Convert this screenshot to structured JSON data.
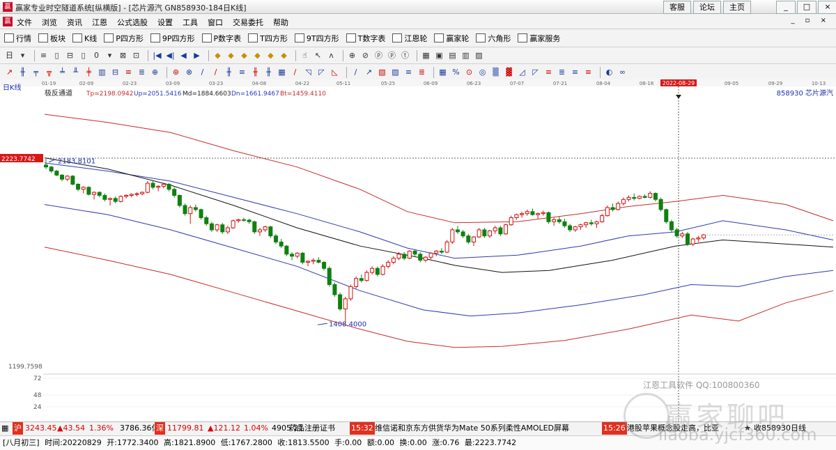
{
  "window": {
    "title": "赢家专业时空隧道系统[纵横版] - [芯片源汽  GN858930-184日K线]",
    "links": [
      "客服",
      "论坛",
      "主页"
    ],
    "controls": [
      "_",
      "□",
      "×"
    ]
  },
  "menu": {
    "items": [
      "文件",
      "浏览",
      "资讯",
      "江恩",
      "公式选股",
      "设置",
      "工具",
      "窗口",
      "交易委托",
      "帮助"
    ],
    "mdi_controls": "_ ▫ ×"
  },
  "toolbar1": [
    {
      "label": "行情",
      "icon": "table-icon"
    },
    {
      "label": "板块",
      "icon": "blocks-icon"
    },
    {
      "label": "K线",
      "icon": "candle-icon"
    },
    {
      "label": "P四方形",
      "icon": "p-square-icon"
    },
    {
      "label": "9P四方形",
      "icon": "9p-square-icon"
    },
    {
      "label": "P数字表",
      "icon": "p-number-icon"
    },
    {
      "label": "T四方形",
      "icon": "t-square-icon"
    },
    {
      "label": "9T四方形",
      "icon": "9t-square-icon"
    },
    {
      "label": "T数字表",
      "icon": "t-number-icon"
    },
    {
      "label": "江恩轮",
      "icon": "gann-wheel-icon"
    },
    {
      "label": "赢家轮",
      "icon": "winner-wheel-icon"
    },
    {
      "label": "六角形",
      "icon": "hexagon-icon"
    },
    {
      "label": "赢家服务",
      "icon": "service-icon"
    }
  ],
  "toolbar2": [
    "日",
    "▾",
    "≡",
    "▯",
    "⊟",
    "▯",
    "0",
    "▾",
    "⊠",
    "⊡",
    "|◀",
    "◀|",
    "◀",
    "▶",
    "◆",
    "◆",
    "◆",
    "◆",
    "◆",
    "◆",
    "☝",
    "↖",
    "ʌ",
    "⊕",
    "⊘",
    "ⓟ",
    "ⓟ",
    "ⓣ",
    "▦",
    "▣",
    "▤",
    "▥",
    "▨"
  ],
  "toolbar3": [
    "↗",
    "╫",
    "╤",
    "╦",
    "╧",
    "╨",
    "╪",
    "▥",
    "⊟",
    "≡",
    "≣",
    "⊕",
    "⊛",
    "⊗",
    "/",
    "/",
    "╫",
    "≡",
    "╫",
    "╫",
    "▦",
    "/",
    "◹",
    "◸",
    "◺",
    "/",
    "↗",
    "▧",
    "▨",
    "≡",
    "≣",
    "▦",
    "%",
    "⊙",
    "◎",
    "▒",
    "▓",
    "◿",
    "◸",
    "≡",
    "≣",
    "≡",
    "≡",
    "◐",
    "∞"
  ],
  "chart": {
    "period": "日K线",
    "indicator": {
      "name": "极反通道",
      "tp": "Tp=2198.0942",
      "up": "Up=2051.5416",
      "md": "Md=1884.6603",
      "dn": "Dn=1661.9467",
      "bt": "Bt=1459.4110"
    },
    "stock": "858930  芯片源汽",
    "dates": [
      "01-19",
      "02-09",
      "02-23",
      "03-09",
      "03-23",
      "04-08",
      "04-22",
      "05-11",
      "05-25",
      "06-09",
      "06-23",
      "07-07",
      "07-21",
      "08-04",
      "08-18",
      "09-05",
      "09-29",
      "10-13"
    ],
    "cursor_date": "2022-08-29",
    "cursor_price": "2223.7742",
    "high_label": "2183.8101",
    "low_label": "1408.4000",
    "bottom_price": "1199.7598",
    "volume_ticks": [
      "72",
      "48",
      "24"
    ],
    "colors": {
      "outer": "#c62b2b",
      "inner": "#2b3ab0",
      "mid": "#111111",
      "up": "#d01010",
      "down": "#108010"
    }
  },
  "chart_data": {
    "type": "candlestick",
    "title": "",
    "ylim": [
      1199.7598,
      2300
    ],
    "candles": [
      [
        2190,
        2220,
        2170,
        2180
      ],
      [
        2180,
        2185,
        2150,
        2160
      ],
      [
        2160,
        2165,
        2135,
        2140
      ],
      [
        2140,
        2145,
        2110,
        2120
      ],
      [
        2120,
        2140,
        2110,
        2135
      ],
      [
        2135,
        2140,
        2090,
        2095
      ],
      [
        2095,
        2100,
        2060,
        2070
      ],
      [
        2070,
        2085,
        2050,
        2080
      ],
      [
        2080,
        2085,
        2040,
        2045
      ],
      [
        2045,
        2060,
        2020,
        2055
      ],
      [
        2055,
        2060,
        2030,
        2040
      ],
      [
        2040,
        2050,
        2010,
        2020
      ],
      [
        2020,
        2030,
        1990,
        2025
      ],
      [
        2025,
        2035,
        2000,
        2010
      ],
      [
        2010,
        2040,
        2005,
        2035
      ],
      [
        2035,
        2045,
        2025,
        2040
      ],
      [
        2040,
        2050,
        2030,
        2045
      ],
      [
        2045,
        2055,
        2035,
        2048
      ],
      [
        2048,
        2060,
        2040,
        2055
      ],
      [
        2055,
        2110,
        2050,
        2100
      ],
      [
        2100,
        2110,
        2070,
        2080
      ],
      [
        2080,
        2090,
        2060,
        2085
      ],
      [
        2085,
        2100,
        2075,
        2095
      ],
      [
        2095,
        2100,
        2060,
        2070
      ],
      [
        2070,
        2080,
        2030,
        2040
      ],
      [
        2040,
        2045,
        1980,
        1990
      ],
      [
        1990,
        2000,
        1940,
        1950
      ],
      [
        1950,
        1990,
        1900,
        1980
      ],
      [
        1980,
        1995,
        1960,
        1970
      ],
      [
        1970,
        1975,
        1920,
        1930
      ],
      [
        1930,
        1940,
        1890,
        1900
      ],
      [
        1900,
        1910,
        1860,
        1870
      ],
      [
        1870,
        1900,
        1860,
        1895
      ],
      [
        1895,
        1905,
        1850,
        1860
      ],
      [
        1860,
        1890,
        1850,
        1880
      ],
      [
        1880,
        1920,
        1875,
        1915
      ],
      [
        1915,
        1925,
        1905,
        1920
      ],
      [
        1920,
        1930,
        1910,
        1918
      ],
      [
        1918,
        1925,
        1900,
        1910
      ],
      [
        1910,
        1915,
        1850,
        1860
      ],
      [
        1860,
        1880,
        1840,
        1870
      ],
      [
        1870,
        1890,
        1860,
        1885
      ],
      [
        1885,
        1890,
        1830,
        1840
      ],
      [
        1840,
        1850,
        1800,
        1810
      ],
      [
        1810,
        1825,
        1780,
        1790
      ],
      [
        1790,
        1795,
        1740,
        1750
      ],
      [
        1750,
        1760,
        1720,
        1740
      ],
      [
        1740,
        1760,
        1730,
        1755
      ],
      [
        1755,
        1760,
        1700,
        1710
      ],
      [
        1710,
        1720,
        1690,
        1715
      ],
      [
        1715,
        1730,
        1700,
        1720
      ],
      [
        1720,
        1735,
        1705,
        1710
      ],
      [
        1710,
        1715,
        1670,
        1680
      ],
      [
        1680,
        1690,
        1590,
        1600
      ],
      [
        1600,
        1610,
        1540,
        1550
      ],
      [
        1550,
        1560,
        1470,
        1480
      ],
      [
        1480,
        1540,
        1410,
        1530
      ],
      [
        1530,
        1600,
        1520,
        1590
      ],
      [
        1590,
        1640,
        1580,
        1630
      ],
      [
        1630,
        1650,
        1610,
        1620
      ],
      [
        1620,
        1670,
        1615,
        1660
      ],
      [
        1660,
        1690,
        1650,
        1680
      ],
      [
        1680,
        1690,
        1640,
        1650
      ],
      [
        1650,
        1700,
        1645,
        1690
      ],
      [
        1690,
        1720,
        1680,
        1710
      ],
      [
        1710,
        1740,
        1700,
        1730
      ],
      [
        1730,
        1760,
        1720,
        1750
      ],
      [
        1750,
        1760,
        1720,
        1730
      ],
      [
        1730,
        1770,
        1725,
        1765
      ],
      [
        1765,
        1775,
        1740,
        1750
      ],
      [
        1750,
        1760,
        1710,
        1720
      ],
      [
        1720,
        1740,
        1710,
        1735
      ],
      [
        1735,
        1760,
        1725,
        1755
      ],
      [
        1755,
        1770,
        1740,
        1765
      ],
      [
        1765,
        1780,
        1750,
        1760
      ],
      [
        1760,
        1820,
        1755,
        1810
      ],
      [
        1810,
        1880,
        1800,
        1870
      ],
      [
        1870,
        1890,
        1850,
        1860
      ],
      [
        1860,
        1870,
        1830,
        1840
      ],
      [
        1840,
        1850,
        1800,
        1810
      ],
      [
        1810,
        1840,
        1790,
        1835
      ],
      [
        1835,
        1880,
        1830,
        1870
      ],
      [
        1870,
        1880,
        1830,
        1840
      ],
      [
        1840,
        1870,
        1830,
        1865
      ],
      [
        1865,
        1890,
        1850,
        1880
      ],
      [
        1880,
        1890,
        1840,
        1850
      ],
      [
        1850,
        1900,
        1845,
        1895
      ],
      [
        1895,
        1940,
        1890,
        1930
      ],
      [
        1930,
        1950,
        1920,
        1945
      ],
      [
        1945,
        1960,
        1930,
        1950
      ],
      [
        1950,
        1970,
        1940,
        1960
      ],
      [
        1960,
        1975,
        1940,
        1945
      ],
      [
        1945,
        1955,
        1925,
        1950
      ],
      [
        1950,
        1965,
        1940,
        1955
      ],
      [
        1955,
        1960,
        1900,
        1910
      ],
      [
        1910,
        1930,
        1890,
        1920
      ],
      [
        1920,
        1935,
        1900,
        1910
      ],
      [
        1910,
        1925,
        1880,
        1890
      ],
      [
        1890,
        1900,
        1860,
        1870
      ],
      [
        1870,
        1890,
        1860,
        1885
      ],
      [
        1885,
        1900,
        1870,
        1895
      ],
      [
        1895,
        1910,
        1880,
        1905
      ],
      [
        1905,
        1920,
        1890,
        1900
      ],
      [
        1900,
        1915,
        1880,
        1910
      ],
      [
        1910,
        1950,
        1905,
        1940
      ],
      [
        1940,
        1990,
        1935,
        1980
      ],
      [
        1980,
        2000,
        1960,
        1970
      ],
      [
        1970,
        2010,
        1965,
        2000
      ],
      [
        2000,
        2030,
        1990,
        2020
      ],
      [
        2020,
        2040,
        2010,
        2030
      ],
      [
        2030,
        2050,
        2015,
        2025
      ],
      [
        2025,
        2040,
        2020,
        2035
      ],
      [
        2035,
        2045,
        2025,
        2030
      ],
      [
        2030,
        2060,
        2025,
        2050
      ],
      [
        2050,
        2055,
        2010,
        2020
      ],
      [
        2020,
        2030,
        1960,
        1970
      ],
      [
        1970,
        1975,
        1900,
        1910
      ],
      [
        1910,
        1920,
        1860,
        1870
      ],
      [
        1870,
        1880,
        1830,
        1840
      ],
      [
        1840,
        1860,
        1830,
        1850
      ],
      [
        1850,
        1860,
        1790,
        1800
      ],
      [
        1800,
        1830,
        1790,
        1825
      ],
      [
        1825,
        1840,
        1810,
        1830
      ],
      [
        1830,
        1850,
        1820,
        1845
      ]
    ]
  },
  "status": {
    "sh_index": "3243.45",
    "sh_change": "▲43.54",
    "sh_pct": "1.36%",
    "sh_amount": "3786.36亿",
    "sz_index": "11799.81",
    "sz_change": "▲121.12",
    "sz_pct": "1.04%",
    "sz_amount": "4905.21",
    "news1": "药品注册证书",
    "news_time1": "15:32",
    "news2": "维信诺和京东方供货华为Mate 50系列柔性AMOLED屏幕",
    "news_time2": "15:26",
    "news3": "港股苹果概念股走高，比亚",
    "fav": "收858930日线"
  },
  "info": {
    "lunar": "[八月初三]",
    "time": "时间:20220829",
    "open": "开:1772.3400",
    "high": "高:1821.8900",
    "low": "低:1767.2800",
    "close": "收:1813.5500",
    "vol": "手:0.00",
    "amount": "额:0.00",
    "turnover": "换:0.00",
    "change": "涨:0.76",
    "max": "最:2223.7742"
  },
  "watermark": {
    "software": "江恩工具软件  QQ:100800360",
    "brand": "赢家聊吧",
    "url": "liaoba.yjcf360.com"
  }
}
